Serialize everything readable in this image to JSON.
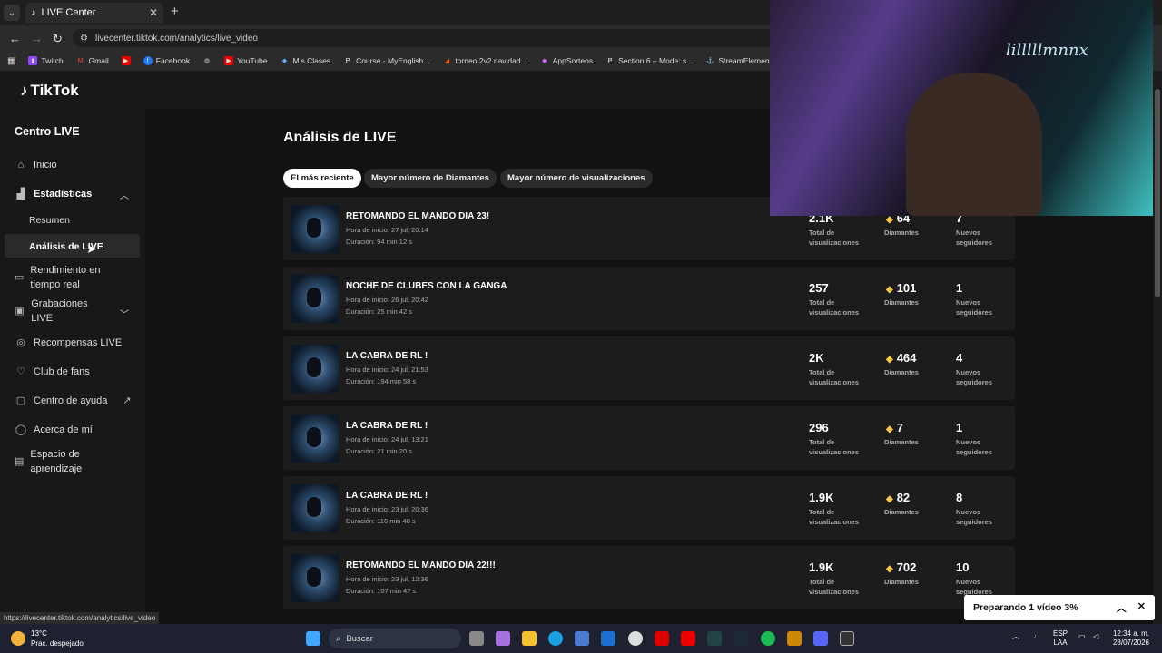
{
  "browser": {
    "tab_title": "LIVE Center",
    "url": "livecenter.tiktok.com/analytics/live_video",
    "status_url": "https://livecenter.tiktok.com/analytics/live_video",
    "bookmarks": [
      "Twitch",
      "Gmail",
      "",
      "Facebook",
      "",
      "YouTube",
      "Mis Clases",
      "Course - MyEnglish...",
      "torneo 2v2 navidad...",
      "AppSorteos",
      "Section 6 – Mode: s...",
      "StreamElements - M...",
      "li"
    ]
  },
  "logo": "TikTok",
  "sidebar": {
    "title": "Centro LIVE",
    "items": [
      {
        "label": "Inicio",
        "icon": "home-icon"
      },
      {
        "label": "Estadísticas",
        "icon": "chart-icon"
      },
      {
        "label": "Rendimiento en tiempo real",
        "icon": "monitor-icon"
      },
      {
        "label": "Grabaciones LIVE",
        "icon": "recording-icon"
      },
      {
        "label": "Recompensas LIVE",
        "icon": "coin-icon"
      },
      {
        "label": "Club de fans",
        "icon": "heart-icon"
      },
      {
        "label": "Centro de ayuda",
        "icon": "help-icon"
      },
      {
        "label": "Acerca de mí",
        "icon": "user-icon"
      },
      {
        "label": "Espacio de aprendizaje",
        "icon": "book-icon"
      }
    ],
    "subitems": [
      "Resumen",
      "Análisis de LIVE"
    ]
  },
  "main": {
    "heading": "Análisis de LIVE",
    "filters": [
      "El más reciente",
      "Mayor número de Diamantes",
      "Mayor número de visualizaciones"
    ],
    "labels": {
      "views": "Total de visualizaciones",
      "diamonds": "Diamantes",
      "followers": "Nuevos seguidores"
    },
    "lives": [
      {
        "title": "RETOMANDO EL MANDO DIA 23!",
        "start": "Hora de inicio: 27 jul, 20:14",
        "duration": "Duración: 94 min 12 s",
        "views": "2.1K",
        "diamonds": "64",
        "followers": "7"
      },
      {
        "title": "NOCHE DE CLUBES CON LA GANGA",
        "start": "Hora de inicio: 26 jul, 20:42",
        "duration": "Duración: 25 min 42 s",
        "views": "257",
        "diamonds": "101",
        "followers": "1"
      },
      {
        "title": "LA CABRA DE RL !",
        "start": "Hora de inicio: 24 jul, 21:53",
        "duration": "Duración: 194 min 58 s",
        "views": "2K",
        "diamonds": "464",
        "followers": "4"
      },
      {
        "title": "LA CABRA DE RL !",
        "start": "Hora de inicio: 24 jul, 13:21",
        "duration": "Duración: 21 min 20 s",
        "views": "296",
        "diamonds": "7",
        "followers": "1"
      },
      {
        "title": "LA CABRA DE RL !",
        "start": "Hora de inicio: 23 jul, 20:36",
        "duration": "Duración: 116 min 40 s",
        "views": "1.9K",
        "diamonds": "82",
        "followers": "8"
      },
      {
        "title": "RETOMANDO EL MANDO DIA 22!!!",
        "start": "Hora de inicio: 23 jul, 12:36",
        "duration": "Duración: 107 min 47 s",
        "views": "1.9K",
        "diamonds": "702",
        "followers": "10"
      }
    ]
  },
  "toast": {
    "text": "Preparando 1 vídeo 3%"
  },
  "taskbar": {
    "weather_temp": "13°C",
    "weather_desc": "Prac. despejado",
    "search_placeholder": "Buscar",
    "lang1": "ESP",
    "lang2": "LAA",
    "time": "12:34 a. m.",
    "date": "28/07/2026"
  },
  "webcam_sign": "lilllllmnnx"
}
